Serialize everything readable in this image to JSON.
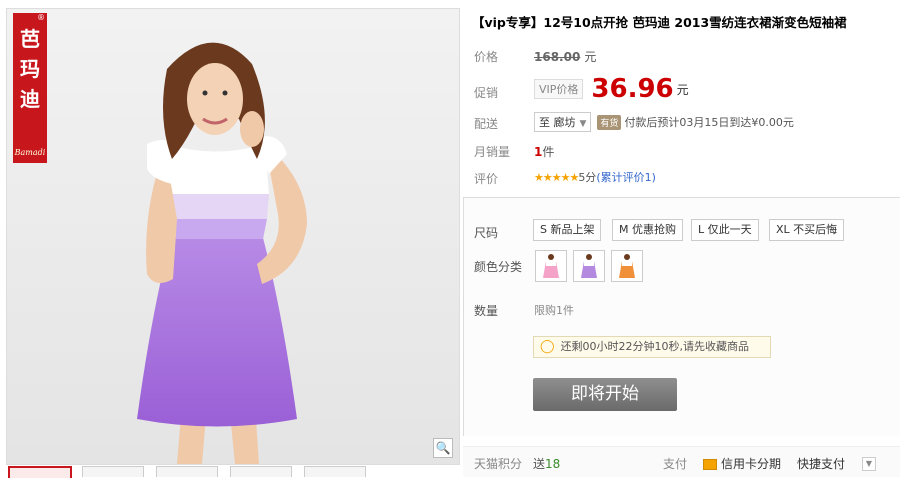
{
  "brand": {
    "logo_chars": [
      "芭",
      "玛",
      "迪"
    ],
    "logo_script": "Bamadi",
    "reg_mark": "®"
  },
  "product": {
    "title": "【vip专享】12号10点开抢 芭玛迪 2013雪纺连衣裙渐变色短袖裙"
  },
  "price": {
    "label": "价格",
    "original": "168.00",
    "unit": "元"
  },
  "promo": {
    "label": "促销",
    "tag": "VIP价格",
    "price": "36.96",
    "unit": "元"
  },
  "delivery": {
    "label": "配送",
    "to_prefix": "至",
    "region": "廊坊",
    "stock_tag": "有货",
    "text": "付款后预计03月15日到达¥0.00元"
  },
  "sales": {
    "label": "月销量",
    "count": "1",
    "unit": "件"
  },
  "rating": {
    "label": "评价",
    "stars": "★★★★★",
    "score": "5分",
    "link": "(累计评价1)"
  },
  "sizes": {
    "label": "尺码",
    "options": [
      "S 新品上架",
      "M 优惠抢购",
      "L 仅此一天",
      "XL 不买后悔"
    ]
  },
  "colors": {
    "label": "颜色分类",
    "count_shown": 3
  },
  "quantity": {
    "label": "数量",
    "limit": "限购1件"
  },
  "notice": {
    "text": "还剩00小时22分钟10秒,请先收藏商品"
  },
  "buy_button": {
    "label": "即将开始"
  },
  "footer": {
    "points_label": "天猫积分",
    "points_value_prefix": "送",
    "points_value": "18",
    "pay_label": "支付",
    "card_pay": "信用卡分期",
    "quick_pay": "快捷支付"
  },
  "colors_theme": {
    "accent": "#c8161d",
    "price_red": "#cc0000",
    "button_gray": "#7e7e7e",
    "dress_purple": "#b48ae0"
  },
  "icons": {
    "zoom": "magnifier-icon",
    "bulb": "lightbulb-icon",
    "card": "credit-card-icon"
  }
}
